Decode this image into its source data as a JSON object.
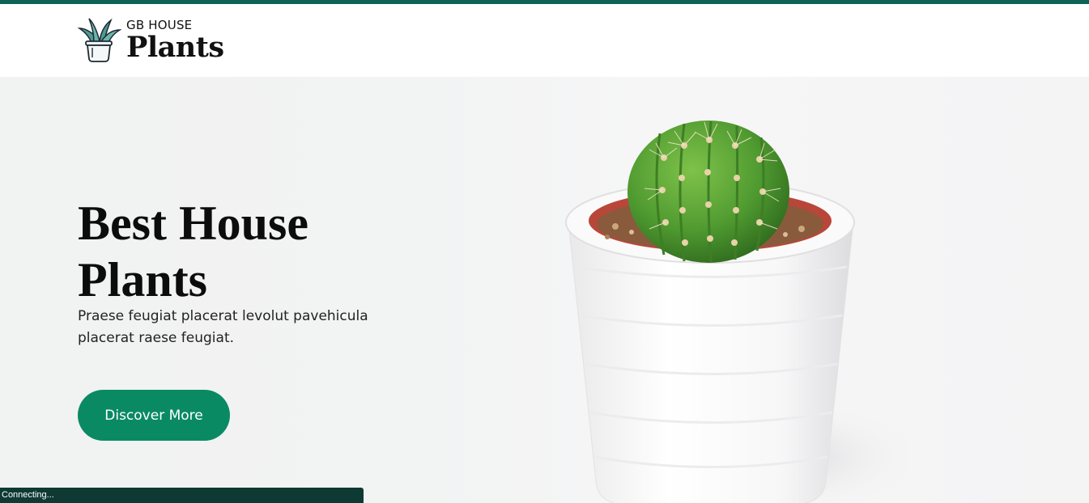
{
  "header": {
    "brand_top": "GB HOUSE",
    "brand_main": "Plants",
    "logo_icon": "potted-plant-icon"
  },
  "hero": {
    "title": "Best House Plants",
    "subtitle": "Praese feugiat placerat levolut pavehicula placerat raese feugiat.",
    "cta_label": "Discover More",
    "image": "cactus-in-white-pot-photo"
  },
  "status_bar": {
    "text": "Connecting..."
  },
  "colors": {
    "accent": "#0f6356",
    "cta": "#0a8a63",
    "status_bar": "#0e3a33"
  }
}
